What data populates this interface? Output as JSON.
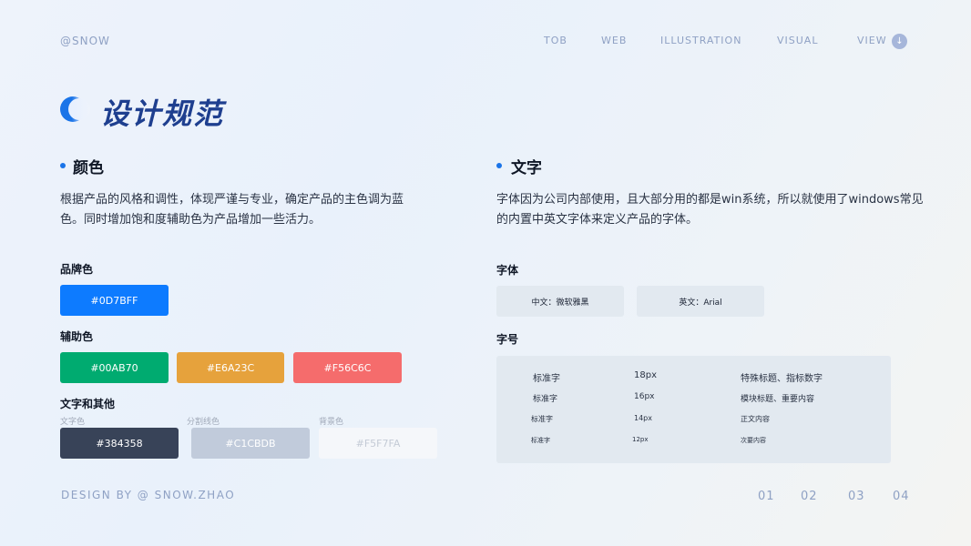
{
  "header": {
    "brand": "@SNOW",
    "nav": [
      "TOB",
      "WEB",
      "ILLUSTRATION",
      "VISUAL",
      "VIEW"
    ],
    "view_icon": "↓"
  },
  "title": "设计规范",
  "color_section": {
    "title": "颜色",
    "description_line1": "根据产品的风格和调性，体现严谨与专业，确定产品的主色调为蓝",
    "description_line2": "色。同时增加饱和度辅助色为产品增加一些活力。",
    "brand_label": "品牌色",
    "brand_color": "#0D7BFF",
    "aux_label": "辅助色",
    "aux_colors": [
      "#00AB70",
      "#E6A23C",
      "#F56C6C"
    ],
    "other_label": "文字和其他",
    "other_items": [
      {
        "label": "文字色",
        "value": "#384358"
      },
      {
        "label": "分割线色",
        "value": "#C1CBDB"
      },
      {
        "label": "背景色",
        "value": "#F5F7FA"
      }
    ]
  },
  "text_section": {
    "title": "文字",
    "description_line1": "字体因为公司内部使用，且大部分用的都是win系统，所以就使用了windows常见",
    "description_line2": "的内置中英文字体来定义产品的字体。",
    "font_label": "字体",
    "fonts": [
      "中文：微软雅黑",
      "英文：Arial"
    ],
    "size_label": "字号",
    "sizes": [
      {
        "name": "标准字",
        "size": "18px",
        "usage": "特殊标题、指标数字"
      },
      {
        "name": "标准字",
        "size": "16px",
        "usage": "模块标题、重要内容"
      },
      {
        "name": "标准字",
        "size": "14px",
        "usage": "正文内容"
      },
      {
        "name": "标准字",
        "size": "12px",
        "usage": "次要内容"
      }
    ]
  },
  "footer": {
    "credit": "DESIGN BY @ SNOW.ZHAO",
    "pages": [
      "01",
      "02",
      "03",
      "04"
    ]
  }
}
